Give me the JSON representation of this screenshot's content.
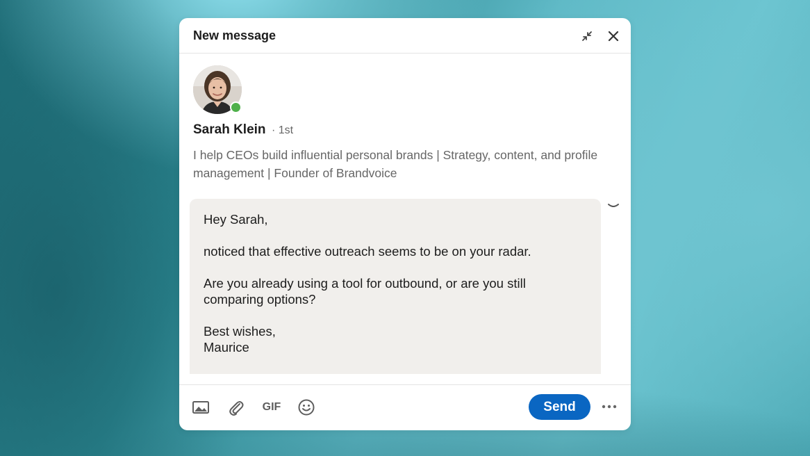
{
  "dialog": {
    "title": "New message",
    "minimize_icon": "minimize-arrows-icon",
    "close_icon": "close-icon"
  },
  "recipient": {
    "name": "Sarah Klein",
    "degree": "· 1st",
    "headline": "I help CEOs build influential personal brands | Strategy, content, and profile management | Founder of Brandvoice",
    "online_color": "#4fb04a",
    "avatar_icon": "profile-photo"
  },
  "message": {
    "greeting": "Hey Sarah,",
    "line1": "noticed that effective outreach seems to be on your radar.",
    "line2": "Are you already using a tool for outbound, or are you still comparing options?",
    "closing": "Best wishes,",
    "signature": "Maurice",
    "collapse_icon": "chevron-down-icon"
  },
  "footer": {
    "image_icon": "image-icon",
    "attach_icon": "paperclip-icon",
    "gif_label": "GIF",
    "emoji_icon": "emoji-icon",
    "send_label": "Send",
    "more_icon": "more-horizontal-icon"
  },
  "colors": {
    "send_button": "#0a66c2",
    "message_background": "#f1efec"
  }
}
